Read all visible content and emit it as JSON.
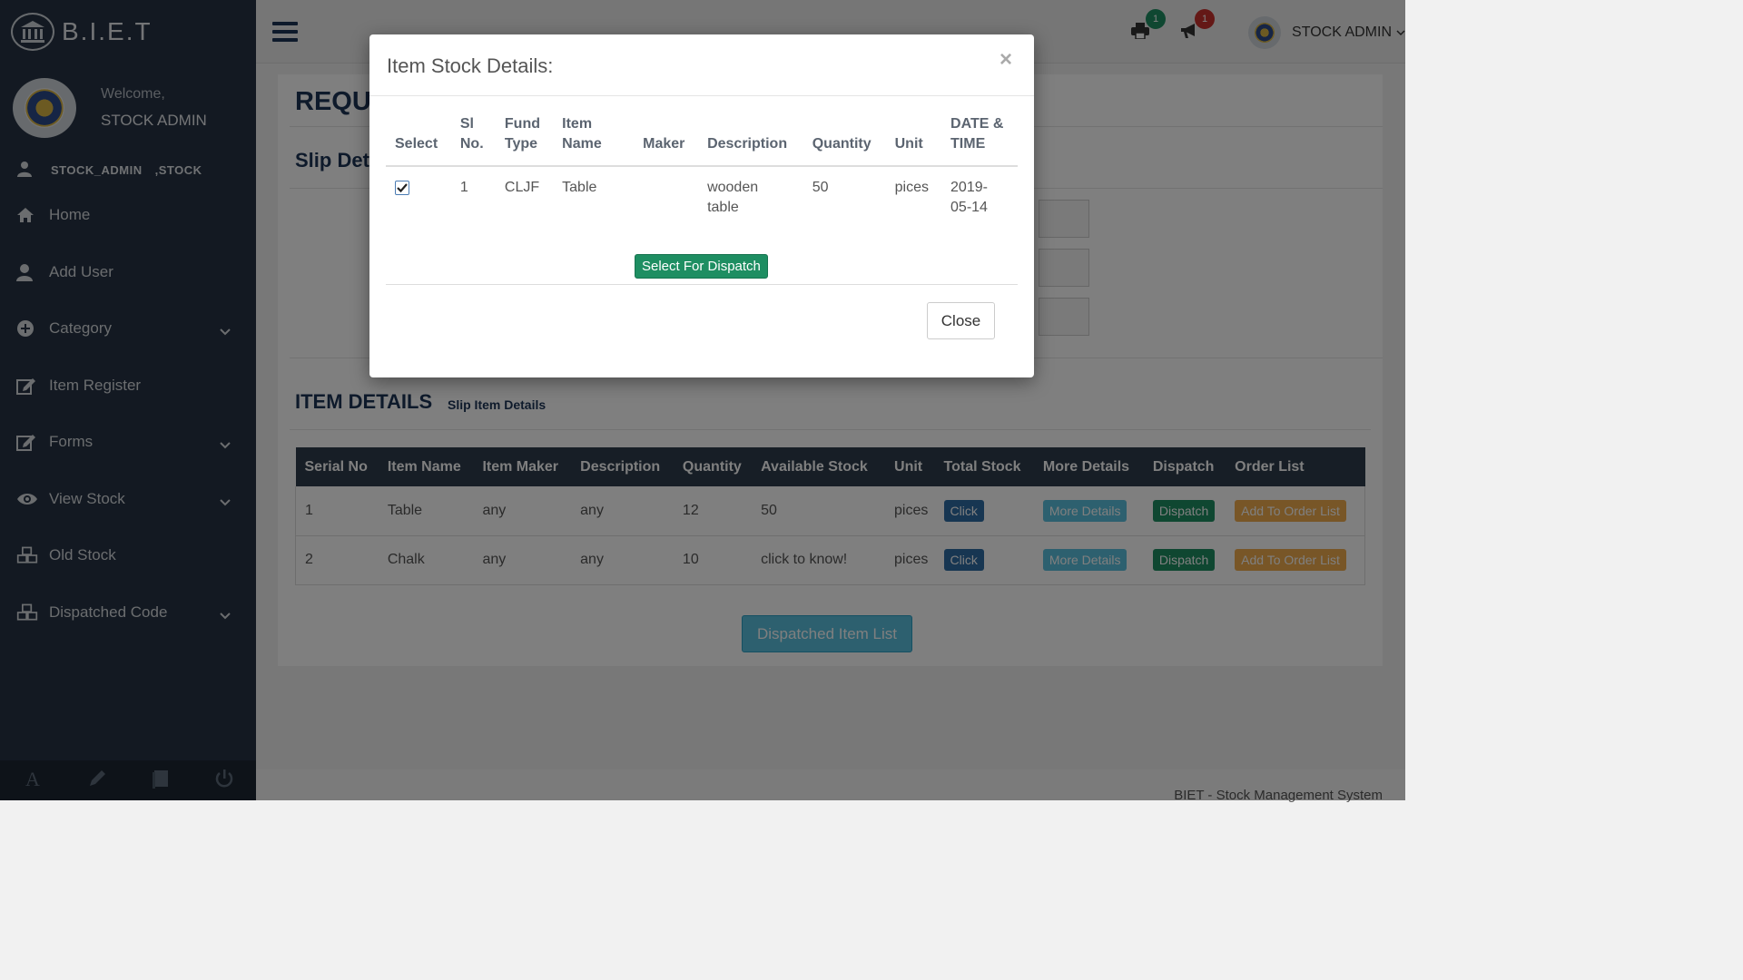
{
  "brand": {
    "name": "B.I.E.T"
  },
  "profile": {
    "welcome": "Welcome,",
    "name": "STOCK ADMIN",
    "role": "STOCK_ADMIN",
    "dept": ",STOCK"
  },
  "sidebar": {
    "items": [
      {
        "label": "Home",
        "icon": "home-icon"
      },
      {
        "label": "Add User",
        "icon": "user-icon"
      },
      {
        "label": "Category",
        "icon": "plus-circle-icon",
        "has_submenu": true
      },
      {
        "label": "Item Register",
        "icon": "edit-icon"
      },
      {
        "label": "Forms",
        "icon": "edit-icon",
        "has_submenu": true
      },
      {
        "label": "View Stock",
        "icon": "eye-icon",
        "has_submenu": true
      },
      {
        "label": "Old Stock",
        "icon": "cubes-icon"
      },
      {
        "label": "Dispatched Code",
        "icon": "cubes-icon",
        "has_submenu": true
      }
    ]
  },
  "header": {
    "print_badge": "1",
    "announce_badge": "1",
    "user_label": "STOCK ADMIN"
  },
  "main": {
    "page_title": "REQU",
    "slip_title": "Slip Det",
    "item_details_title": "ITEM DETAILS",
    "item_details_subtitle": "Slip Item Details",
    "table": {
      "headers": [
        "Serial No",
        "Item Name",
        "Item Maker",
        "Description",
        "Quantity",
        "Available Stock",
        "Unit",
        "Total Stock",
        "More Details",
        "Dispatch",
        "Order List"
      ],
      "rows": [
        {
          "serial": "1",
          "name": "Table",
          "maker": "any",
          "description": "any",
          "quantity": "12",
          "available": "50",
          "unit": "pices",
          "total_btn": "Click",
          "more_btn": "More Details",
          "dispatch_btn": "Dispatch",
          "order_btn": "Add To Order List"
        },
        {
          "serial": "2",
          "name": "Chalk",
          "maker": "any",
          "description": "any",
          "quantity": "10",
          "available": "click to know!",
          "unit": "pices",
          "total_btn": "Click",
          "more_btn": "More Details",
          "dispatch_btn": "Dispatch",
          "order_btn": "Add To Order List"
        }
      ]
    },
    "dispatched_list_button": "Dispatched Item List",
    "footer": "BIET - Stock Management System"
  },
  "modal": {
    "title": "Item Stock Details:",
    "close_x": "×",
    "headers": [
      {
        "l1": "Select",
        "l2": ""
      },
      {
        "l1": "Sl",
        "l2": "No."
      },
      {
        "l1": "Fund",
        "l2": "Type"
      },
      {
        "l1": "Item",
        "l2": "Name"
      },
      {
        "l1": "Maker",
        "l2": ""
      },
      {
        "l1": "Description",
        "l2": ""
      },
      {
        "l1": "Quantity",
        "l2": ""
      },
      {
        "l1": "Unit",
        "l2": ""
      },
      {
        "l1": "DATE &",
        "l2": "TIME"
      }
    ],
    "row": {
      "checked": true,
      "sl": "1",
      "fund_type": "CLJF",
      "item_name": "Table",
      "maker": "",
      "description_l1": "wooden",
      "description_l2": "table",
      "quantity": "50",
      "unit": "pices",
      "date_l1": "2019-",
      "date_l2": "05-14"
    },
    "select_button": "Select For Dispatch",
    "close_button": "Close"
  },
  "colors": {
    "sidebar_bg": "#263344",
    "table_header_bg": "#2e3d4d",
    "success": "#1e8e62",
    "info": "#5bc0de",
    "warning": "#f0ad4e",
    "primary": "#2e6da4",
    "badge_green": "#1e8e62",
    "badge_red": "#c9302c"
  }
}
